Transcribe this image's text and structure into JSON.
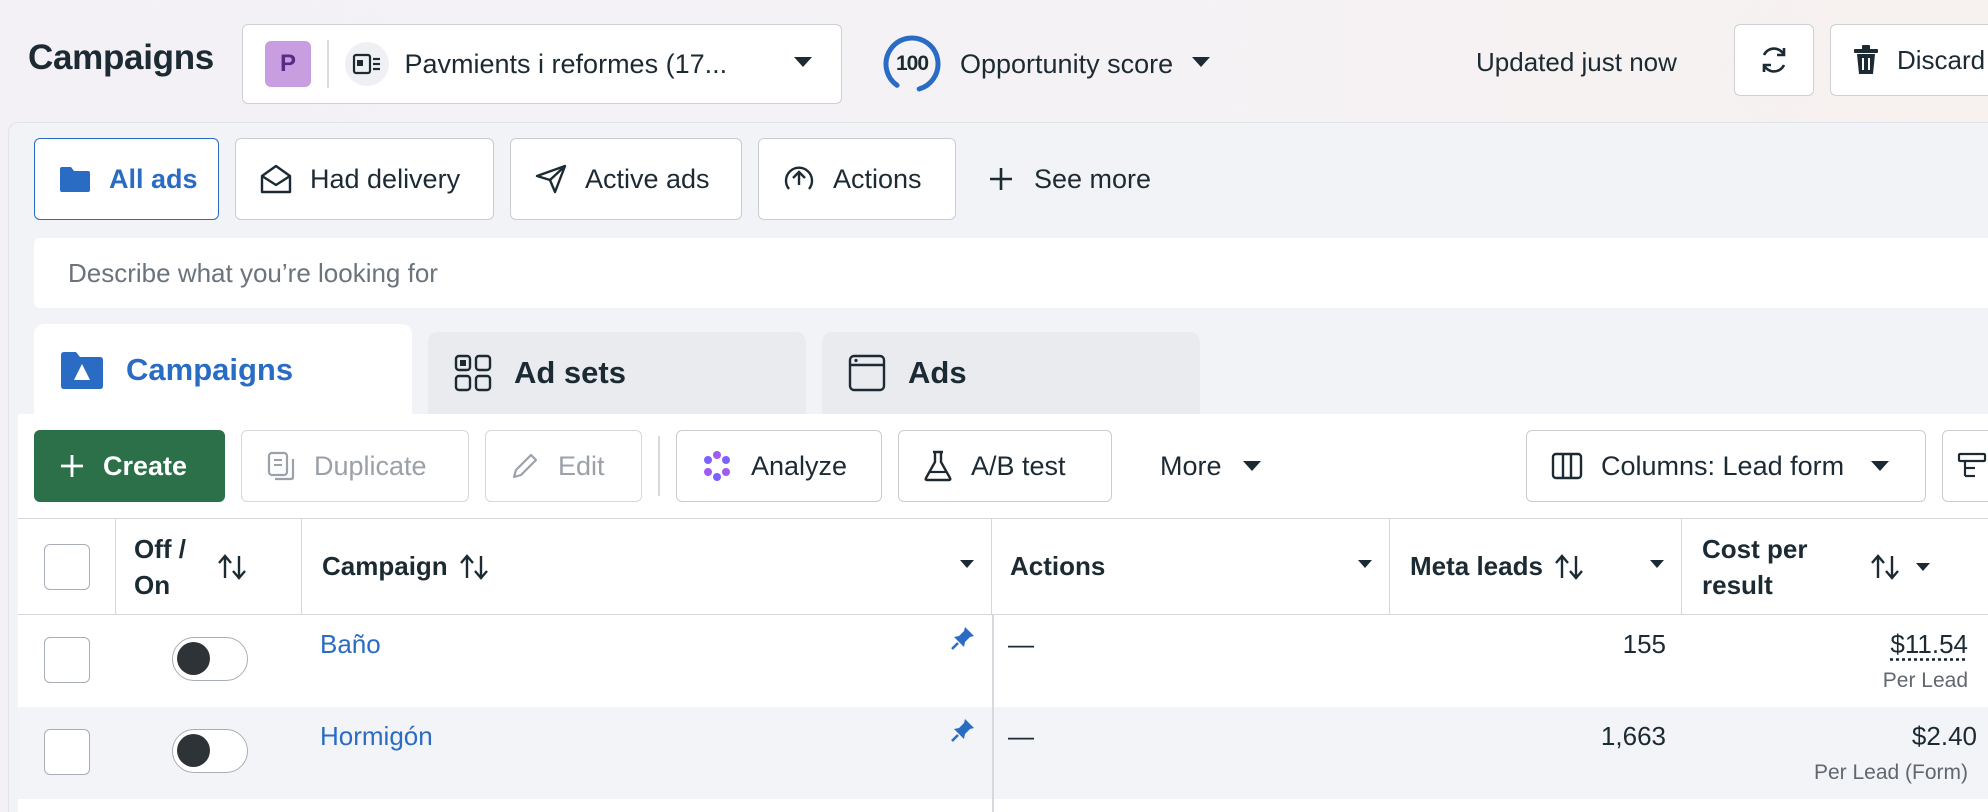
{
  "header": {
    "title": "Campaigns",
    "account": {
      "avatar_letter": "P",
      "name": "Pavmients i reformes (17..."
    },
    "opportunity": {
      "score": "100",
      "label": "Opportunity score"
    },
    "updated": "Updated just now",
    "discard_label": "Discard"
  },
  "filters": {
    "items": [
      {
        "label": "All ads",
        "icon": "folder-icon"
      },
      {
        "label": "Had delivery",
        "icon": "envelope-icon"
      },
      {
        "label": "Active ads",
        "icon": "send-icon"
      },
      {
        "label": "Actions",
        "icon": "upload-circle-icon"
      }
    ],
    "see_more": "See more"
  },
  "search": {
    "placeholder": "Describe what you’re looking for"
  },
  "tabs": [
    {
      "label": "Campaigns",
      "icon": "campaign-folder-icon",
      "active": true
    },
    {
      "label": "Ad sets",
      "icon": "grid-icon",
      "active": false
    },
    {
      "label": "Ads",
      "icon": "ad-window-icon",
      "active": false
    }
  ],
  "toolbar": {
    "create": "Create",
    "duplicate": "Duplicate",
    "edit": "Edit",
    "analyze": "Analyze",
    "ab_test": "A/B test",
    "more": "More",
    "columns": "Columns: Lead form"
  },
  "table": {
    "headers": {
      "off_on_line1": "Off /",
      "off_on_line2": "On",
      "campaign": "Campaign",
      "actions": "Actions",
      "meta_leads": "Meta leads",
      "cost_line1": "Cost per",
      "cost_line2": "result"
    },
    "rows": [
      {
        "campaign": "Baño",
        "actions": "—",
        "meta_leads": "155",
        "cost": "$11.54",
        "cost_sub": "Per Lead",
        "on": false,
        "pinned": true
      },
      {
        "campaign": "Hormigón",
        "actions": "—",
        "meta_leads": "1,663",
        "cost": "$2.40",
        "cost_sub": "Per Lead (Form)",
        "on": false,
        "pinned": true
      }
    ]
  },
  "colors": {
    "accent_blue": "#2a6cc4",
    "create_green": "#2b7049",
    "score_ring": "#2a6cc4",
    "avatar_purple": "#c89ee0"
  }
}
